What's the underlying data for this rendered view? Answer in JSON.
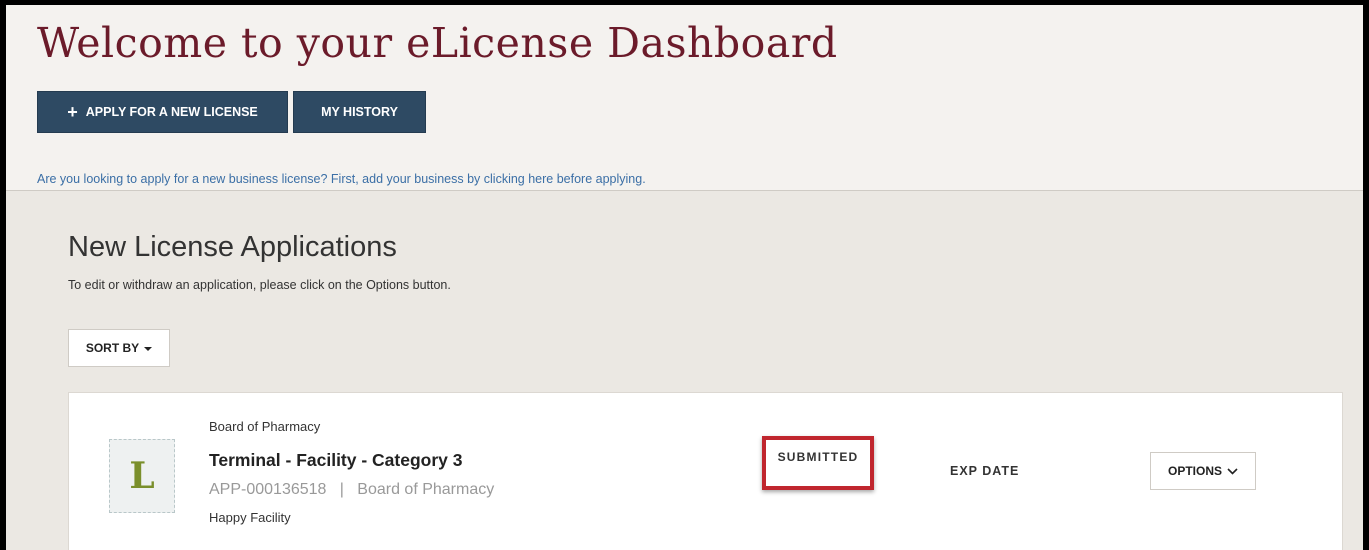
{
  "header": {
    "title": "Welcome to your eLicense Dashboard",
    "apply_label": "APPLY FOR A NEW LICENSE",
    "history_label": "MY HISTORY",
    "business_link": "Are you looking to apply for a new business license? First, add your business by clicking here before applying."
  },
  "section": {
    "title": "New License Applications",
    "description": "To edit or withdraw an application, please click on the Options button.",
    "sort_label": "SORT BY"
  },
  "application": {
    "board": "Board of Pharmacy",
    "license_name": "Terminal - Facility - Category 3",
    "app_id": "APP-000136518",
    "separator": "|",
    "app_board": "Board of Pharmacy",
    "facility": "Happy Facility",
    "status": "SUBMITTED",
    "exp_date_label": "EXP DATE",
    "options_label": "OPTIONS",
    "icon_letter": "L"
  },
  "icons": {
    "plus": "plus-icon",
    "caret": "caret-down-icon",
    "chevron": "chevron-down-icon",
    "license": "license-icon"
  },
  "colors": {
    "title": "#6b1b2a",
    "button": "#2e4a63",
    "link": "#3b6fa6",
    "highlight": "#c0262e"
  }
}
